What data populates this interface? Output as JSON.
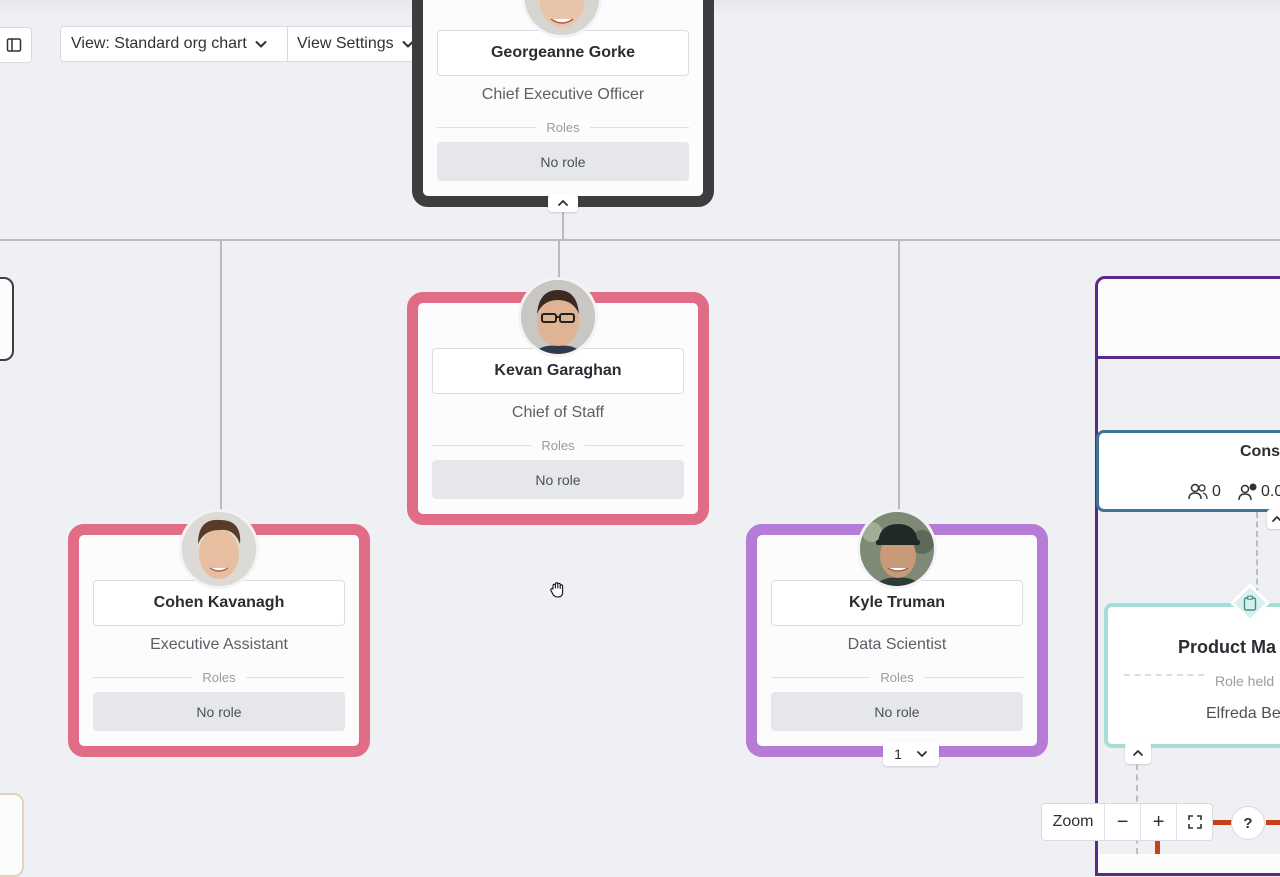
{
  "toolbar": {
    "view_label": "View: Standard org chart",
    "settings_label": "View Settings"
  },
  "cards": {
    "ceo": {
      "name": "Georgeanne Gorke",
      "title": "Chief Executive Officer",
      "roles_label": "Roles",
      "role_value": "No role",
      "border_color": "#3d3c3f"
    },
    "chief_of_staff": {
      "name": "Kevan Garaghan",
      "title": "Chief of Staff",
      "roles_label": "Roles",
      "role_value": "No role",
      "border_color": "#e06c86"
    },
    "exec_assistant": {
      "name": "Cohen Kavanagh",
      "title": "Executive Assistant",
      "roles_label": "Roles",
      "role_value": "No role",
      "border_color": "#e06c86"
    },
    "data_scientist": {
      "name": "Kyle Truman",
      "title": "Data Scientist",
      "roles_label": "Roles",
      "role_value": "No role",
      "border_color": "#b57bd6",
      "reports_count": "1"
    }
  },
  "team_panel": {
    "team_name": "Cons",
    "members_count": "0",
    "fte_count": "0.0",
    "role_card": {
      "title": "Product Ma",
      "role_held_label": "Role held",
      "holder": "Elfreda Be"
    }
  },
  "zoom": {
    "label": "Zoom",
    "minus": "−",
    "plus": "+"
  },
  "help": {
    "label": "?"
  },
  "icons": [
    "sidebar-toggle-icon",
    "chevron-down-icon",
    "chevron-up-icon",
    "people-icon",
    "person-fte-icon",
    "clipboard-icon",
    "fullscreen-icon",
    "grab-hand-icon"
  ]
}
